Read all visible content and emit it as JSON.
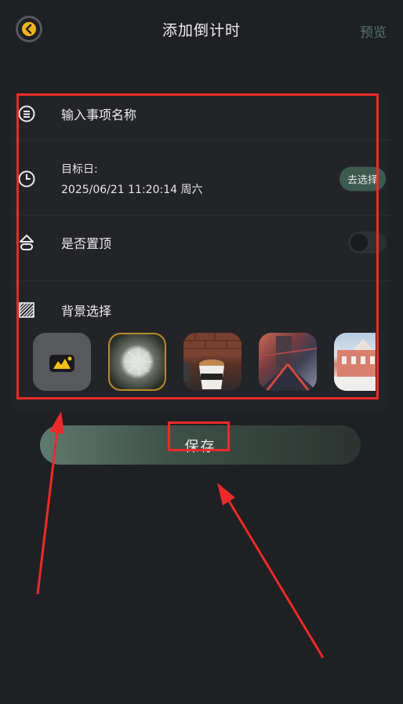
{
  "header": {
    "title": "添加倒计时",
    "preview_label": "预览"
  },
  "form": {
    "name_placeholder": "输入事项名称",
    "target_date_label": "目标日:",
    "target_date_value": "2025/06/21 11:20:14 周六",
    "choose_button": "去选择",
    "pin_label": "是否置顶",
    "pin_enabled": false,
    "background_label": "背景选择",
    "backgrounds": [
      "camera-upload",
      "dandelion",
      "coffee-doughnut",
      "tower-bridge",
      "red-building"
    ],
    "selected_background": "dandelion"
  },
  "save_label": "保存",
  "colors": {
    "background": "#1f2023",
    "accent": "#52766a",
    "annotation": "#ec2a2a",
    "selected_border": "#b98a2b"
  }
}
